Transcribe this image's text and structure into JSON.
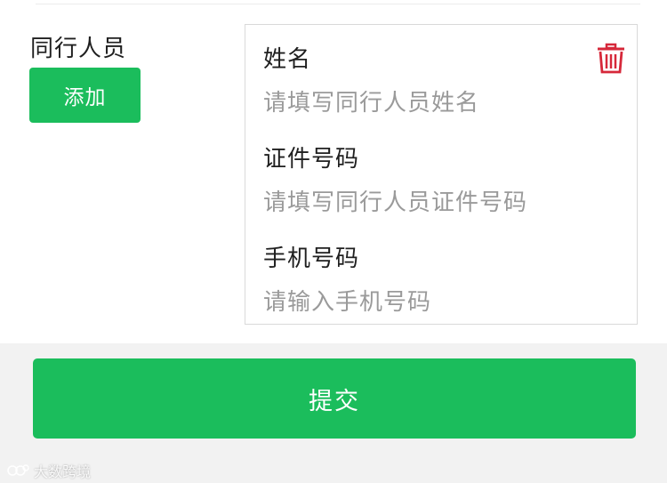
{
  "companions": {
    "label": "同行人员",
    "add_button_label": "添加"
  },
  "companion_entry": {
    "name_label": "姓名",
    "name_placeholder": "请填写同行人员姓名",
    "id_label": "证件号码",
    "id_placeholder": "请填写同行人员证件号码",
    "phone_label": "手机号码",
    "phone_placeholder": "请输入手机号码",
    "delete_icon": "trash-icon"
  },
  "submit_label": "提交",
  "watermark": {
    "text": "大数跨境"
  },
  "colors": {
    "accent": "#1bbd5c",
    "delete": "#d6283a"
  }
}
